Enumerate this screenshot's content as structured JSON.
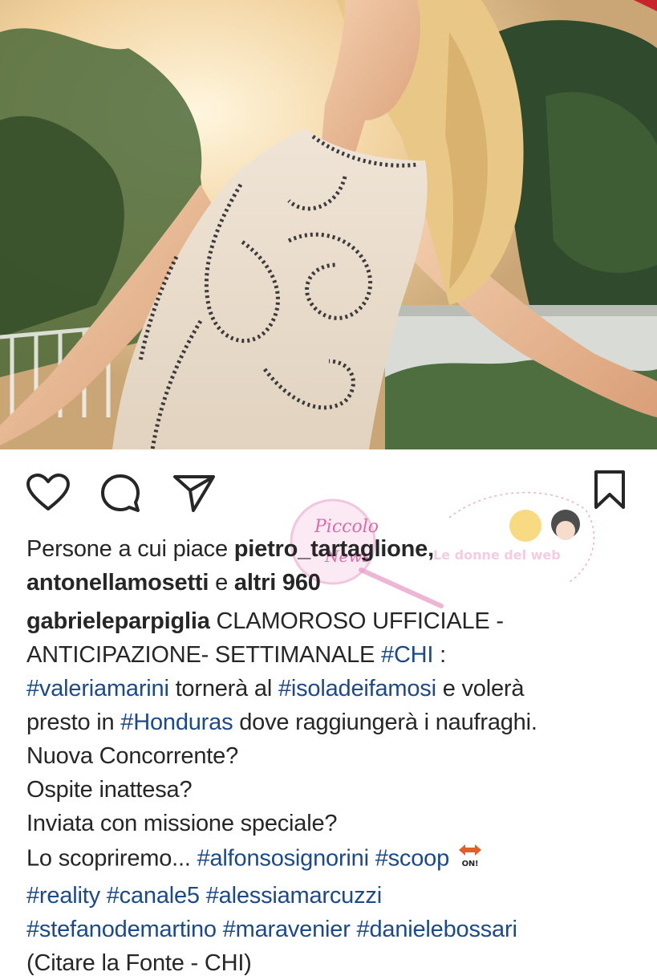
{
  "post": {
    "likes": {
      "prefix": "Persone a cui piace",
      "user1": "pietro_tartaglione,",
      "user2": "antonellamosetti",
      "conj": "e",
      "others": "altri 960"
    },
    "caption": {
      "author": "gabrieleparpiglia",
      "l1_text": " CLAMOROSO UFFICIALE -",
      "l2_text": "ANTICIPAZIONE- SETTIMANALE ",
      "l2_tag": "#CHI",
      "l2_end": " :",
      "l3_tag1": "#valeriamarini",
      "l3_text1": " tornerà al ",
      "l3_tag2": "#isoladeifamosi",
      "l3_text2": " e volerà",
      "l4_text1": "presto in ",
      "l4_tag": "#Honduras",
      "l4_text2": " dove raggiungerà i naufraghi.",
      "l5": "Nuova Concorrente?",
      "l6": "Ospite inattesa?",
      "l7": "Inviata con missione speciale?",
      "l8_text": "Lo scopriremo... ",
      "l8_tag1": "#alfonsosignorini",
      "l8_tag2": "#scoop",
      "l8_emoji": "on-arrow-emoji",
      "l9_tag1": "#reality",
      "l9_tag2": "#canale5",
      "l9_tag3": "#alessiamarcuzzi",
      "l10_tag1": "#stefanodemartino",
      "l10_tag2": "#maravenier",
      "l10_tag3": "#danielebossari",
      "l11": "(Citare la Fonte - CHI)"
    }
  },
  "actions": {
    "like_icon": "heart-icon",
    "comment_icon": "comment-icon",
    "share_icon": "send-icon",
    "save_icon": "bookmark-icon"
  },
  "watermark": {
    "text1": "Piccolo",
    "text2": "News",
    "text3": "Le donne del web"
  },
  "colors": {
    "hashtag": "#1d4a87",
    "text": "#262626"
  }
}
